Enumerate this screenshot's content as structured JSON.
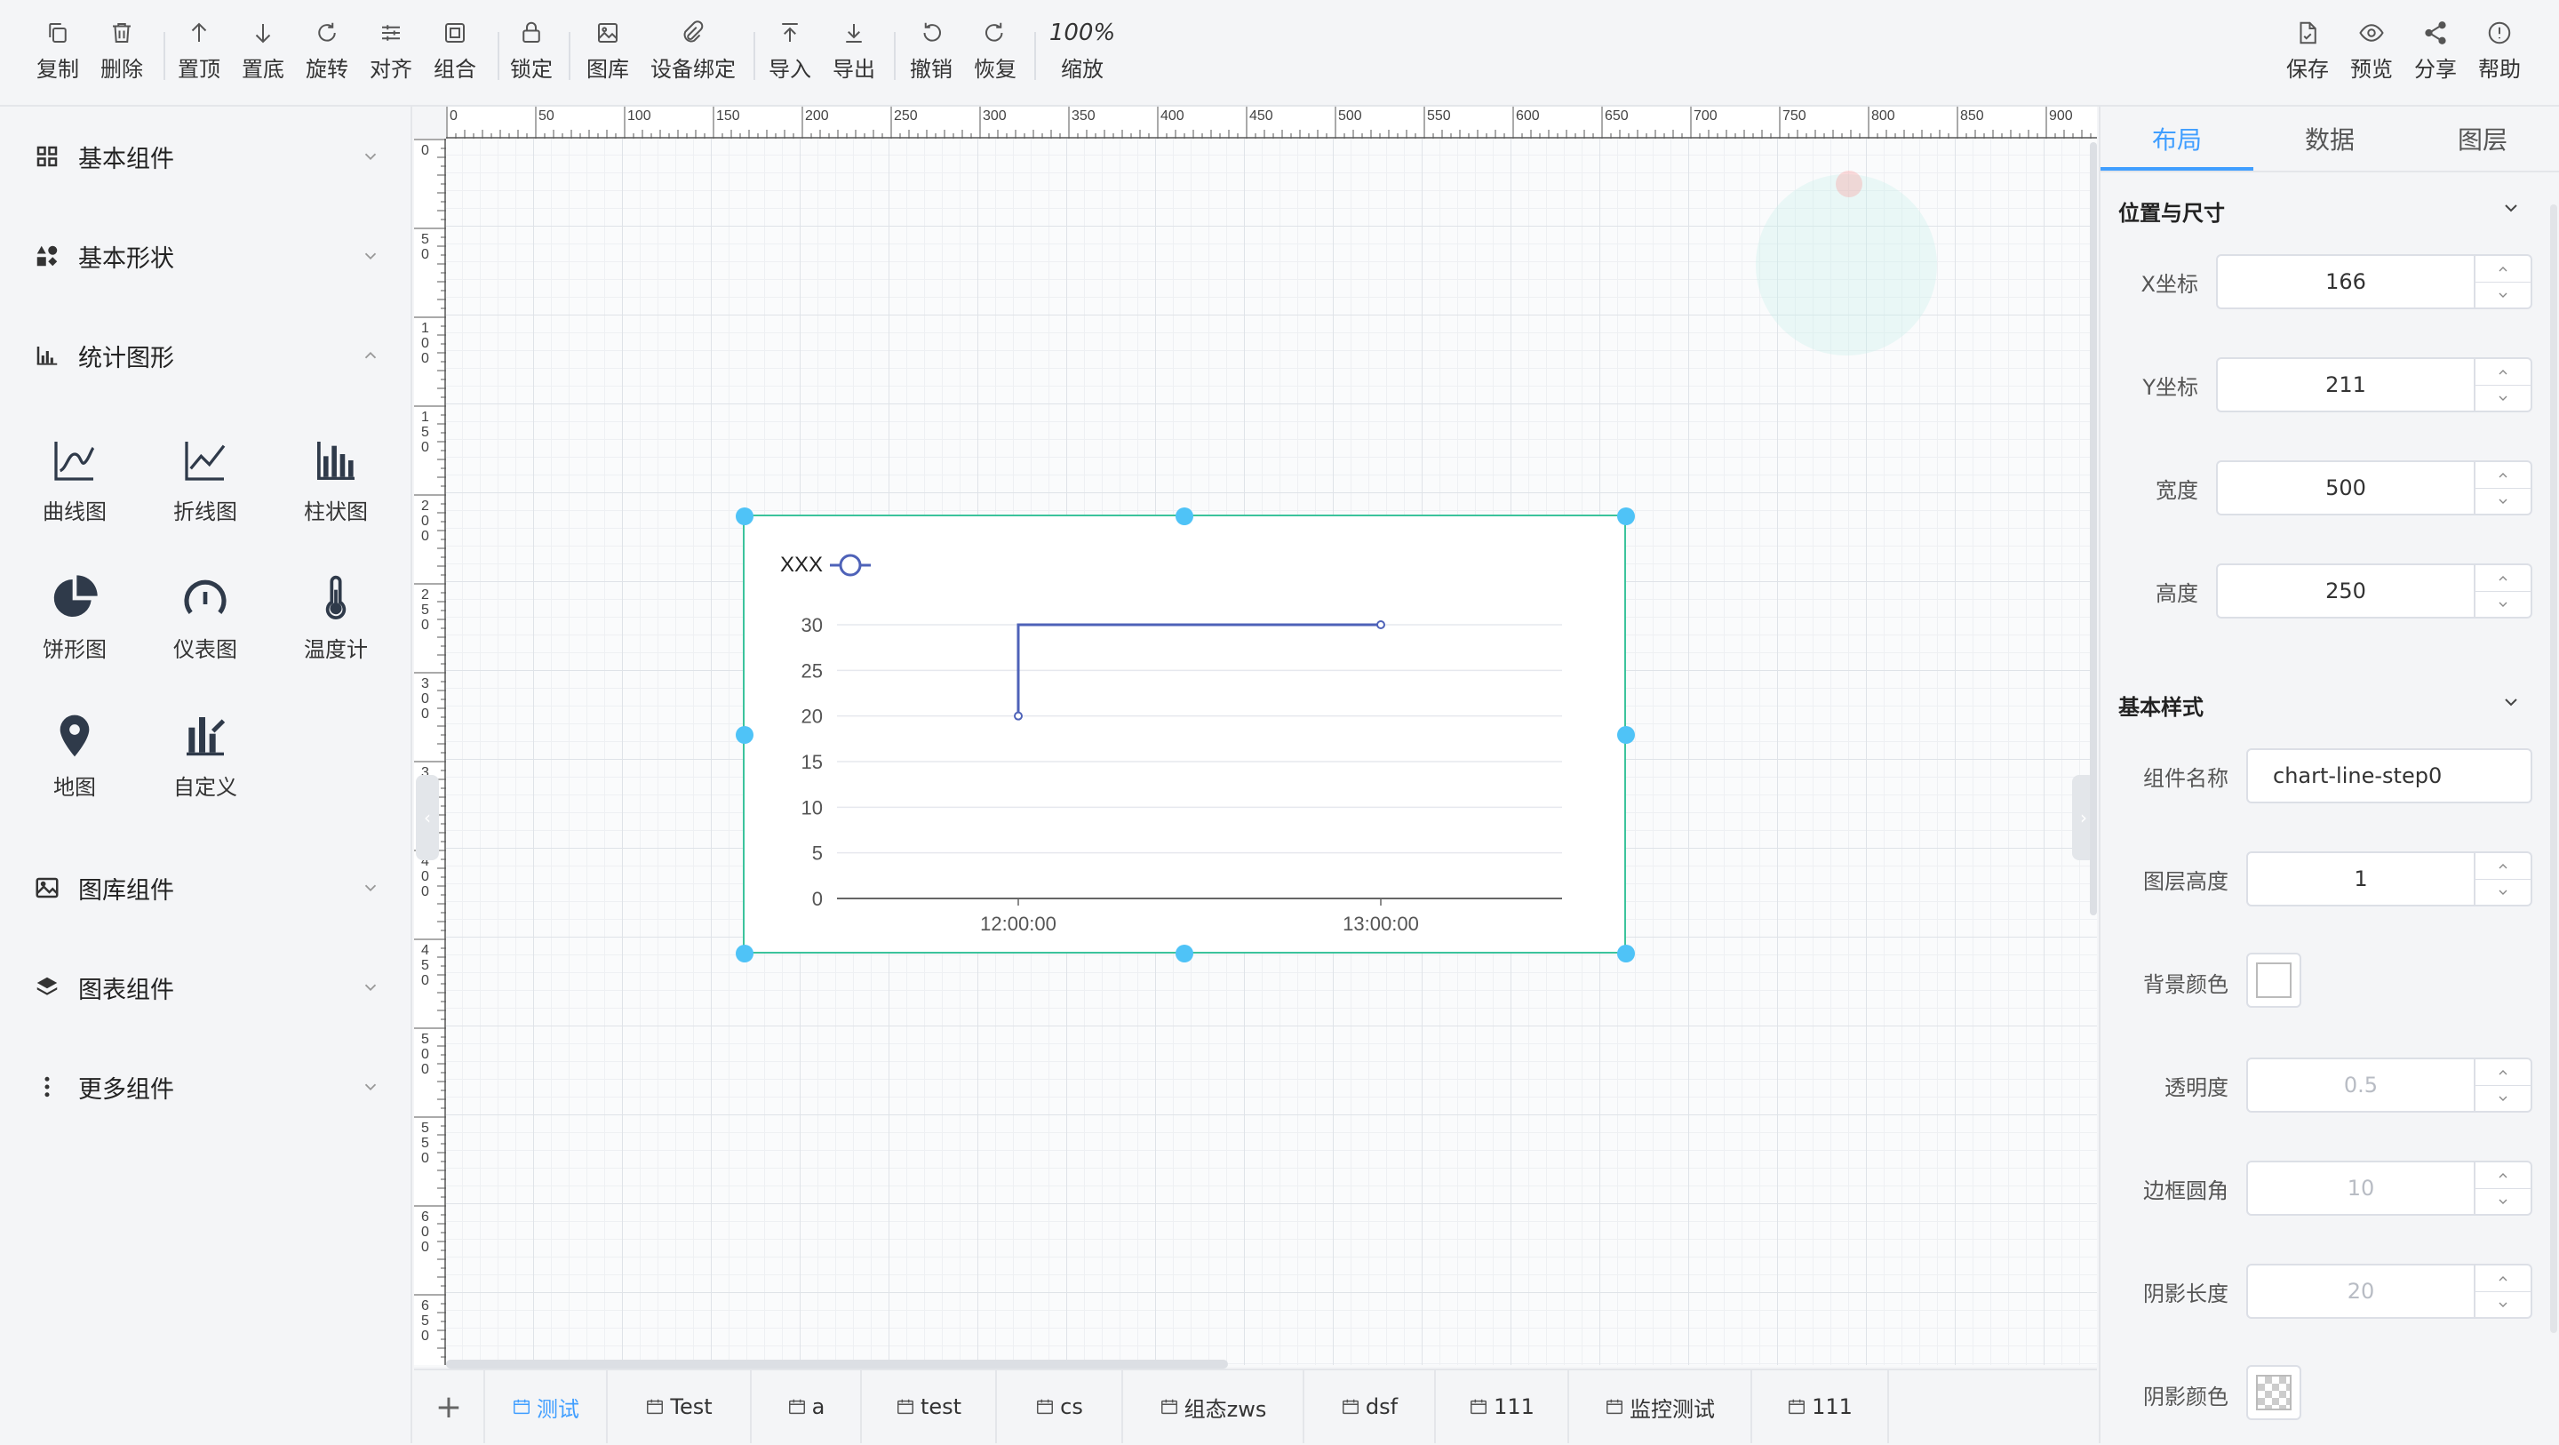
{
  "toolbar": {
    "left": [
      {
        "id": "copy",
        "label": "复制",
        "icon": "copy-icon"
      },
      {
        "id": "delete",
        "label": "删除",
        "icon": "trash-icon"
      },
      {
        "id": "top",
        "label": "置顶",
        "icon": "arrow-up-icon"
      },
      {
        "id": "bottom",
        "label": "置底",
        "icon": "arrow-down-icon"
      },
      {
        "id": "rotate",
        "label": "旋转",
        "icon": "rotate-icon"
      },
      {
        "id": "align",
        "label": "对齐",
        "icon": "align-icon"
      },
      {
        "id": "group",
        "label": "组合",
        "icon": "group-icon"
      },
      {
        "id": "lock",
        "label": "锁定",
        "icon": "lock-icon"
      },
      {
        "id": "gallery",
        "label": "图库",
        "icon": "image-icon"
      },
      {
        "id": "bind",
        "label": "设备绑定",
        "icon": "link-icon"
      },
      {
        "id": "import",
        "label": "导入",
        "icon": "import-icon"
      },
      {
        "id": "export",
        "label": "导出",
        "icon": "export-icon"
      },
      {
        "id": "undo",
        "label": "撤销",
        "icon": "undo-icon"
      },
      {
        "id": "redo",
        "label": "恢复",
        "icon": "redo-icon"
      }
    ],
    "zoom": {
      "value": "100%",
      "label": "缩放"
    },
    "right": [
      {
        "id": "save",
        "label": "保存",
        "icon": "file-save-icon"
      },
      {
        "id": "preview",
        "label": "预览",
        "icon": "eye-icon"
      },
      {
        "id": "share",
        "label": "分享",
        "icon": "share-icon"
      },
      {
        "id": "help",
        "label": "帮助",
        "icon": "info-icon"
      }
    ]
  },
  "left_panel": {
    "categories": [
      {
        "label": "基本组件",
        "icon": "grid-icon",
        "expanded": false
      },
      {
        "label": "基本形状",
        "icon": "shapes-icon",
        "expanded": false
      },
      {
        "label": "统计图形",
        "icon": "bar-chart-icon",
        "expanded": true
      },
      {
        "label": "图库组件",
        "icon": "picture-icon",
        "expanded": false
      },
      {
        "label": "图表组件",
        "icon": "layers-icon",
        "expanded": false
      },
      {
        "label": "更多组件",
        "icon": "more-vertical-icon",
        "expanded": false
      }
    ],
    "stat_components": [
      {
        "label": "曲线图",
        "icon": "curve-chart-icon"
      },
      {
        "label": "折线图",
        "icon": "line-chart-icon"
      },
      {
        "label": "柱状图",
        "icon": "column-chart-icon"
      },
      {
        "label": "饼形图",
        "icon": "pie-chart-icon"
      },
      {
        "label": "仪表图",
        "icon": "gauge-icon"
      },
      {
        "label": "温度计",
        "icon": "thermometer-icon"
      },
      {
        "label": "地图",
        "icon": "map-pin-icon"
      },
      {
        "label": "自定义",
        "icon": "custom-chart-icon"
      }
    ]
  },
  "ruler": {
    "top_labels": [
      "0",
      "50",
      "100",
      "150",
      "200",
      "250",
      "300",
      "350",
      "400",
      "450",
      "500",
      "550",
      "600",
      "650",
      "700",
      "750",
      "800",
      "850",
      "900"
    ],
    "left_labels": [
      "0",
      "50",
      "100",
      "150",
      "200",
      "250",
      "300",
      "350",
      "400",
      "450",
      "500",
      "550",
      "600",
      "650"
    ]
  },
  "chart_data": {
    "type": "line",
    "title": "",
    "legend": {
      "entries": [
        "XXX"
      ],
      "position": "top-left"
    },
    "x_ticks": [
      "12:00:00",
      "13:00:00"
    ],
    "y_ticks": [
      0,
      5,
      10,
      15,
      20,
      25,
      30
    ],
    "ylim": [
      0,
      30
    ],
    "step": "start",
    "series": [
      {
        "name": "XXX",
        "x": [
          "12:00:00",
          "13:00:00"
        ],
        "values": [
          20,
          30
        ],
        "color": "#4e62b8"
      }
    ],
    "grid": true
  },
  "tabs": [
    {
      "label": "测试",
      "active": true
    },
    {
      "label": "Test",
      "active": false
    },
    {
      "label": "a",
      "active": false
    },
    {
      "label": "test",
      "active": false
    },
    {
      "label": "cs",
      "active": false
    },
    {
      "label": "组态zws",
      "active": false
    },
    {
      "label": "dsf",
      "active": false
    },
    {
      "label": "111",
      "active": false
    },
    {
      "label": "监控测试",
      "active": false
    },
    {
      "label": "111",
      "active": false
    }
  ],
  "right_panel": {
    "tabs": [
      "布局",
      "数据",
      "图层"
    ],
    "active_tab": "布局",
    "position_section": "位置与尺寸",
    "fields_position": [
      {
        "label": "X坐标",
        "value": "166"
      },
      {
        "label": "Y坐标",
        "value": "211"
      },
      {
        "label": "宽度",
        "value": "500"
      },
      {
        "label": "高度",
        "value": "250"
      }
    ],
    "style_section": "基本样式",
    "component_name_label": "组件名称",
    "component_name_value": "chart-line-step0",
    "layer_height_label": "图层高度",
    "layer_height_value": "1",
    "bg_color_label": "背景颜色",
    "opacity_label": "透明度",
    "opacity_placeholder": "0.5",
    "radius_label": "边框圆角",
    "radius_placeholder": "10",
    "shadow_len_label": "阴影长度",
    "shadow_len_placeholder": "20",
    "shadow_color_label": "阴影颜色"
  },
  "colors": {
    "accent": "#409eff",
    "selection": "#3cc39c",
    "handle": "#4fc3f7",
    "series": "#4e62b8"
  }
}
